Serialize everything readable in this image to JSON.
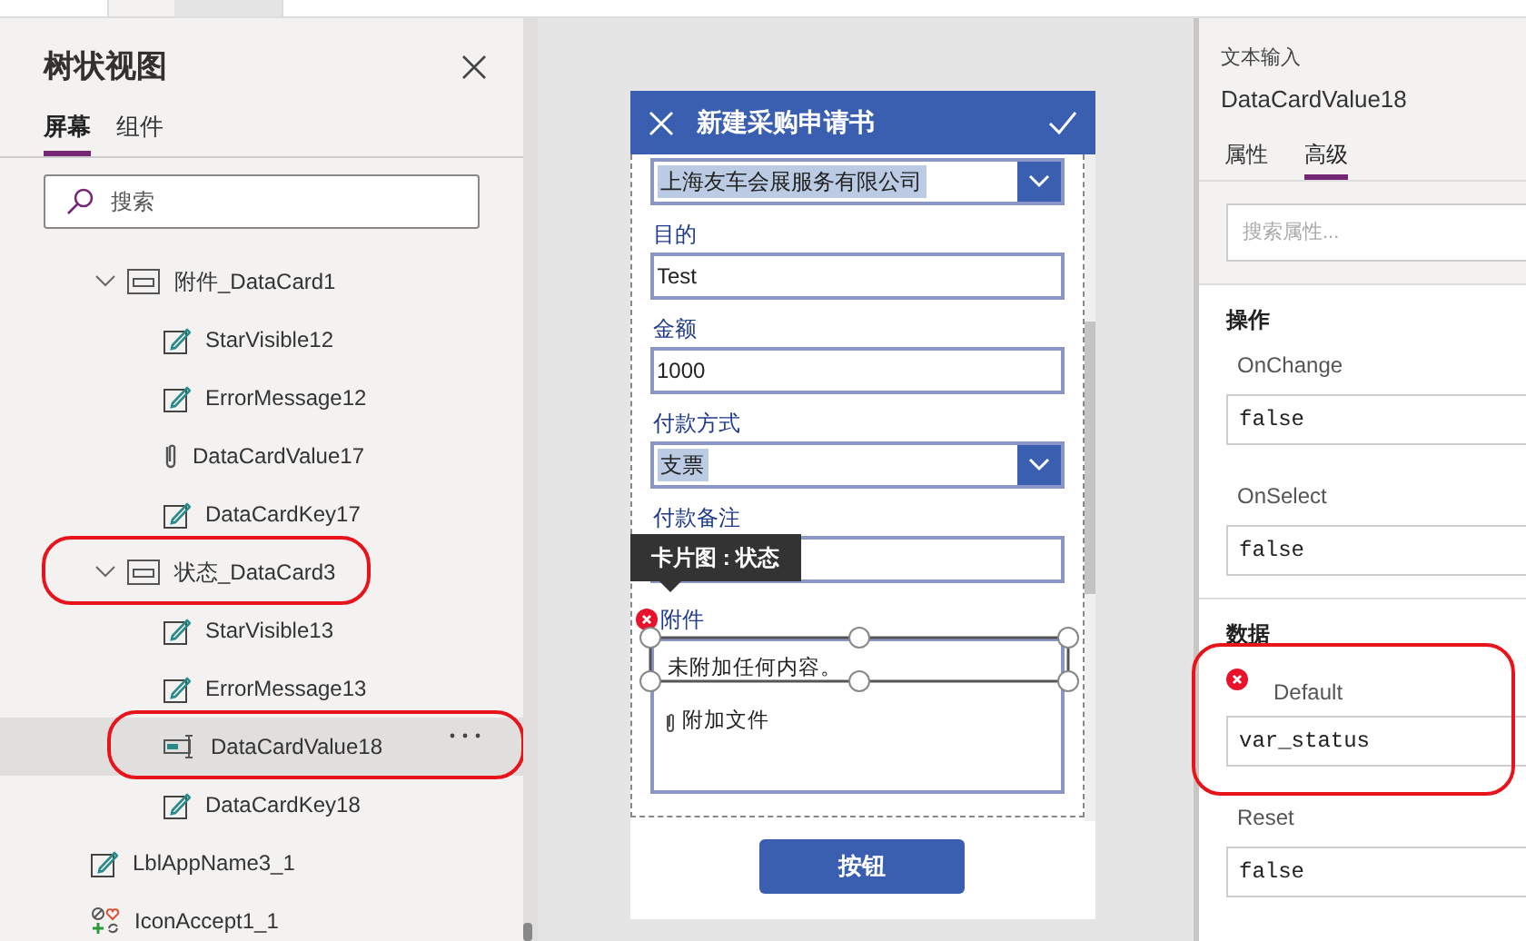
{
  "tree_view": {
    "title": "树状视图",
    "tabs": [
      {
        "label": "屏幕",
        "selected": true
      },
      {
        "label": "组件",
        "selected": false
      }
    ],
    "search": {
      "placeholder": "搜索"
    },
    "items": [
      {
        "kind": "card",
        "label": "附件_DataCard1",
        "expanded": true,
        "selected": false,
        "circled": false,
        "children": [
          {
            "kind": "label",
            "label": "StarVisible12",
            "selected": false,
            "circled": false
          },
          {
            "kind": "label",
            "label": "ErrorMessage12",
            "selected": false,
            "circled": false
          },
          {
            "kind": "attachment",
            "label": "DataCardValue17",
            "selected": false,
            "circled": false
          },
          {
            "kind": "label",
            "label": "DataCardKey17",
            "selected": false,
            "circled": false
          }
        ]
      },
      {
        "kind": "card",
        "label": "状态_DataCard3",
        "expanded": true,
        "selected": false,
        "circled": true,
        "children": [
          {
            "kind": "label",
            "label": "StarVisible13",
            "selected": false,
            "circled": false
          },
          {
            "kind": "label",
            "label": "ErrorMessage13",
            "selected": false,
            "circled": false
          },
          {
            "kind": "input",
            "label": "DataCardValue18",
            "selected": true,
            "circled": true
          },
          {
            "kind": "label",
            "label": "DataCardKey18",
            "selected": false,
            "circled": false
          }
        ]
      },
      {
        "kind": "label",
        "label": "LblAppName3_1",
        "selected": false,
        "circled": false
      },
      {
        "kind": "icons",
        "label": "IconAccept1_1",
        "selected": false,
        "circled": false
      }
    ]
  },
  "form": {
    "title": "新建采购申请书",
    "fields": [
      {
        "kind": "dropdown",
        "value": "上海友车会展服务有限公司"
      },
      {
        "kind": "text",
        "label": "目的",
        "value": "Test"
      },
      {
        "kind": "text",
        "label": "金额",
        "value": "1000"
      },
      {
        "kind": "dropdown",
        "label": "付款方式",
        "value": "支票"
      },
      {
        "kind": "text",
        "label": "付款备注"
      }
    ],
    "tooltip": "卡片图 : 状态",
    "attachment": {
      "label": "附件",
      "error": true,
      "empty_text": "未附加任何内容。",
      "attach_link": "附加文件"
    },
    "button": "按钮"
  },
  "properties": {
    "type": "文本输入",
    "name": "DataCardValue18",
    "tabs": [
      {
        "label": "属性",
        "selected": false
      },
      {
        "label": "高级",
        "selected": true
      }
    ],
    "search": {
      "placeholder": "搜索属性..."
    },
    "sections": [
      {
        "title": "操作",
        "properties": [
          {
            "name": "OnChange",
            "value": "false",
            "error": false,
            "circled": false
          },
          {
            "name": "OnSelect",
            "value": "false",
            "error": false,
            "circled": false
          }
        ]
      },
      {
        "title": "数据",
        "properties": [
          {
            "name": "Default",
            "value": "var_status",
            "error": true,
            "circled": true
          },
          {
            "name": "Reset",
            "value": "false",
            "error": false,
            "circled": false
          }
        ]
      }
    ]
  }
}
